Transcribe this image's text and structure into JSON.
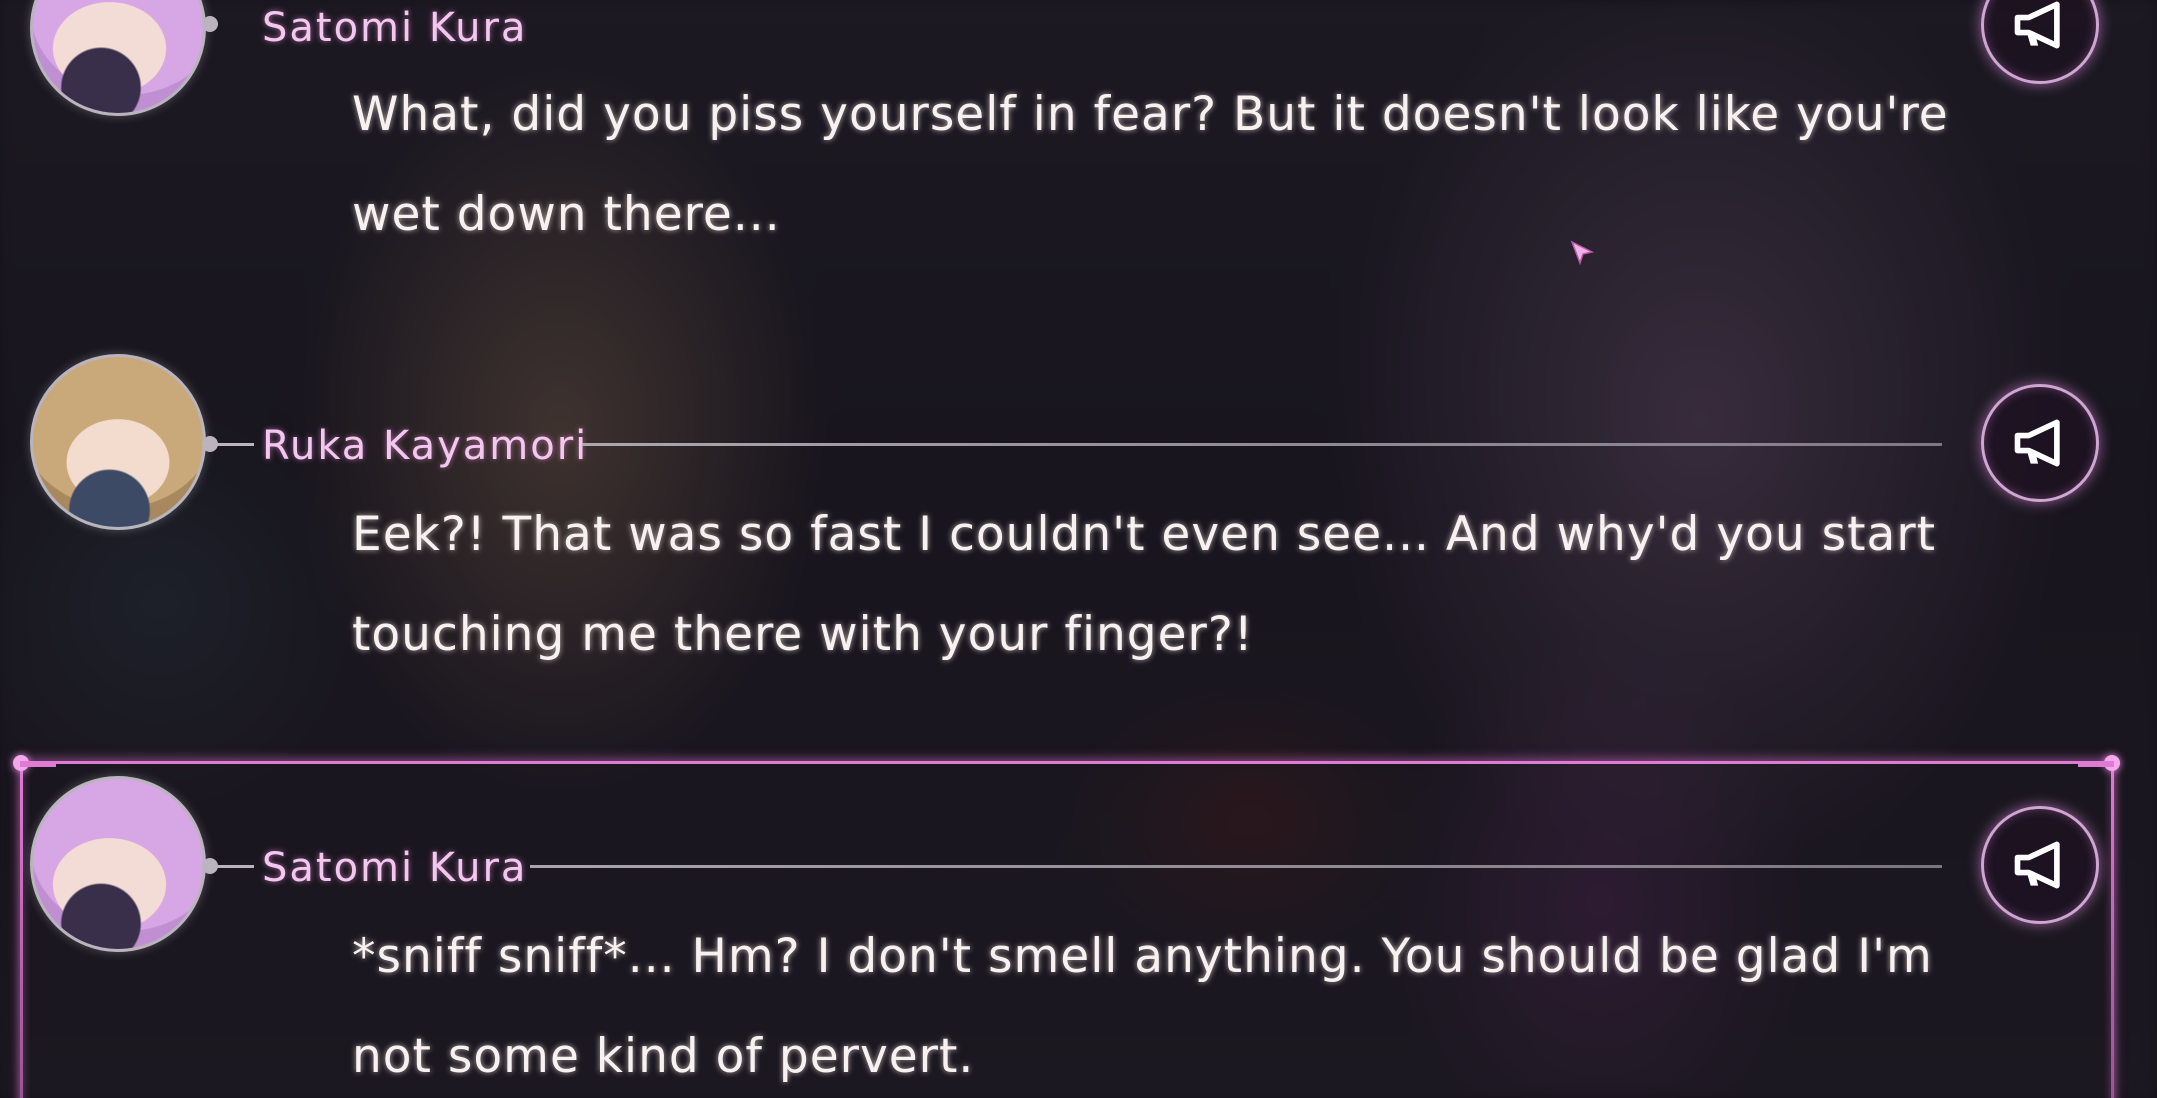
{
  "log": [
    {
      "speaker": "Satomi Kura",
      "avatar": "satomi-portrait",
      "text": "What, did you piss yourself in fear? But it doesn't look like you're wet down there...",
      "voice_icon": "megaphone-icon"
    },
    {
      "speaker": "Ruka Kayamori",
      "avatar": "ruka-portrait",
      "text": "Eek?! That was so fast I couldn't even see... And why'd you start touching me there with your finger?!",
      "voice_icon": "megaphone-icon"
    },
    {
      "speaker": "Satomi Kura",
      "avatar": "satomi-portrait",
      "text": "*sniff sniff*... Hm? I don't smell anything. You should be glad I'm not some kind of pervert.",
      "voice_icon": "megaphone-icon",
      "selected": true
    }
  ],
  "colors": {
    "speaker_name": "#f2c8ef",
    "dialogue_text": "#f7f1f2",
    "selection_frame": "#e07bd4",
    "voice_button_ring": "#cfa5d2"
  }
}
